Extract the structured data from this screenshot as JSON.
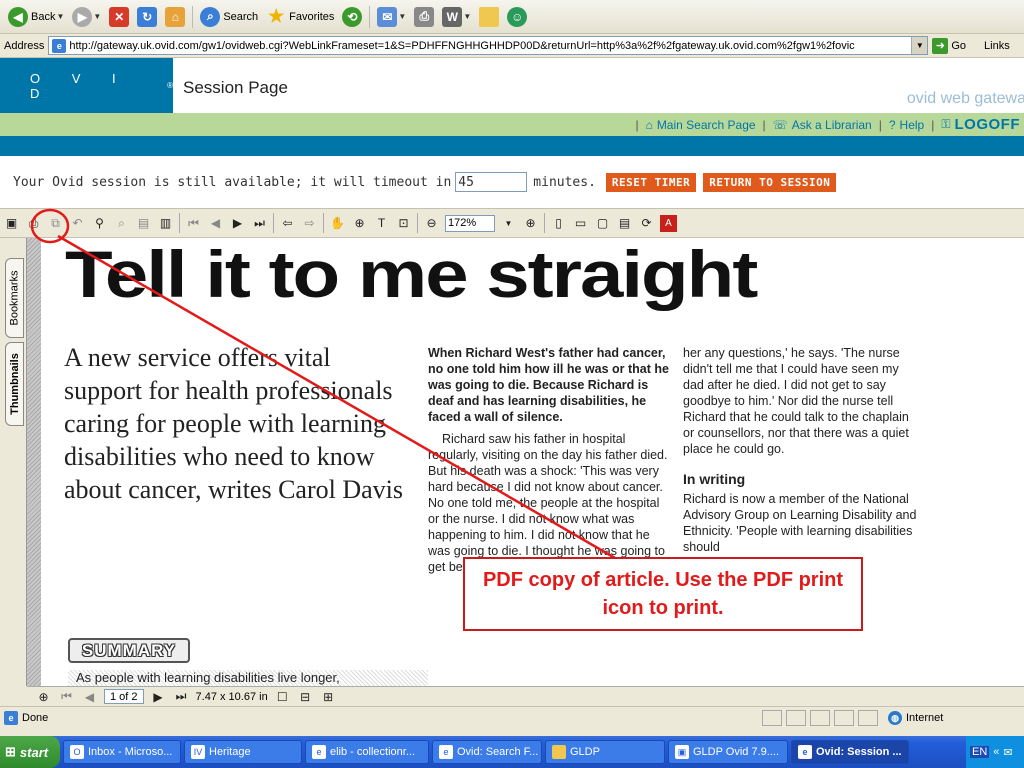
{
  "ie": {
    "back_label": "Back",
    "search_label": "Search",
    "favorites_label": "Favorites",
    "address_label": "Address",
    "url": "http://gateway.uk.ovid.com/gw1/ovidweb.cgi?WebLinkFrameset=1&S=PDHFFNGHHGHHDP00D&returnUrl=http%3a%2f%2fgateway.uk.ovid.com%2fgw1%2fovic",
    "go_label": "Go",
    "links_label": "Links",
    "status_text": "Done",
    "zone_text": "Internet"
  },
  "ovid": {
    "logo_letters": "O V I D",
    "logo_sup": "®",
    "page_title": "Session Page",
    "tagline": "ovid web gateway",
    "nav": {
      "main_search": "Main Search Page",
      "ask_librarian": "Ask a Librarian",
      "help": "Help",
      "logoff": "LOGOFF"
    },
    "session": {
      "prefix": "Your Ovid session is still available; it will timeout in",
      "timeout_value": "45",
      "suffix": "minutes.",
      "reset_button": "RESET TIMER",
      "return_button": "RETURN TO SESSION"
    }
  },
  "acrobat": {
    "zoom": "172%",
    "tab_bookmarks": "Bookmarks",
    "tab_thumbnails": "Thumbnails",
    "page_indicator": "1 of 2",
    "page_size": "7.47 x 10.67 in"
  },
  "article": {
    "headline": "Tell it to me straight",
    "standfirst": "A new service offers vital support for health professionals caring for people with learning disabilities who need to know about cancer, writes Carol Davis",
    "col1_lead": "When Richard West's father had cancer, no one told him how ill he was or that he was going to die. Because Richard is deaf and has learning disabilities, he faced a wall of silence.",
    "col1_body": "Richard saw his father in hospital regularly, visiting on the day his father died. But his death was a shock: 'This was very hard because I did not know about cancer. No one told me, the people at the hospital or the nurse. I did not know what was happening to him. I did not know that he was going to die. I thought he was going to get better.'",
    "col2_body": "her any questions,' he says. 'The nurse didn't tell me that I could have seen my dad after he died. I did not get to say goodbye to him.' Nor did the nurse tell Richard that he could talk to the chaplain or counsellors, nor that there was a quiet place he could go.",
    "col2_heading": "In writing",
    "col2_body2": "Richard is now a member of the National Advisory Group on Learning Disability and Ethnicity. 'People with learning disabilities should",
    "summary_label": "SUMMARY",
    "summary_text": "As people with learning disabilities live longer,"
  },
  "annotation": {
    "callout_text": "PDF copy of article.  Use the PDF print icon to print.",
    "color": "#e21a1a"
  },
  "taskbar": {
    "start_label": "start",
    "tasks": [
      {
        "label": "Inbox - Microso...",
        "active": false
      },
      {
        "label": "Heritage",
        "active": false
      },
      {
        "label": "elib - collectionr...",
        "active": false
      },
      {
        "label": "Ovid: Search F...",
        "active": false
      },
      {
        "label": "GLDP",
        "active": false
      },
      {
        "label": "GLDP Ovid 7.9....",
        "active": false
      },
      {
        "label": "Ovid: Session ...",
        "active": true
      }
    ],
    "tray_lang": "EN"
  }
}
